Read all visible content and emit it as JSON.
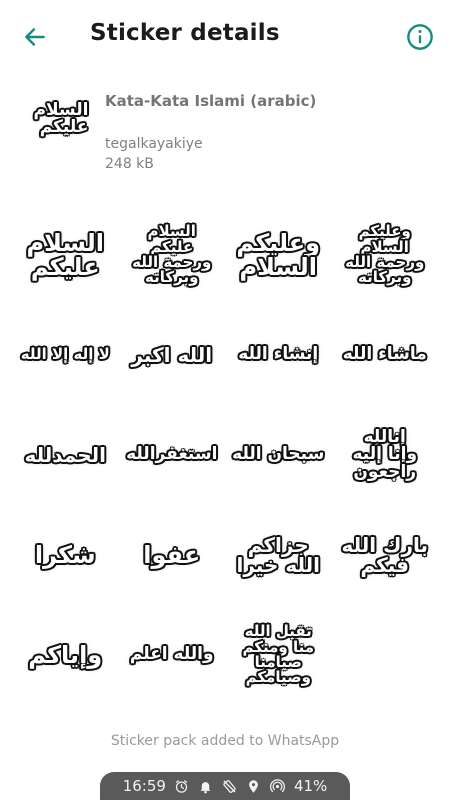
{
  "appbar": {
    "title": "Sticker details"
  },
  "pack": {
    "thumbnail_text": "السلام\nعليكم",
    "name": "Kata-Kata Islami (arabic)",
    "author": "tegalkayakiye",
    "size": "248 kB"
  },
  "stickers": [
    {
      "text": "السلام\nعليكم",
      "size": "s-xl"
    },
    {
      "text": "السلام\nعليكم\nورحمة الله\nوبركاته",
      "size": "s-s"
    },
    {
      "text": "وعليكم\nالسلام",
      "size": "s-xl"
    },
    {
      "text": "وعليكم\nالسلام\nورحمة الله\nوبركاته",
      "size": "s-s"
    },
    {
      "text": "لا إله إلا الله",
      "size": "s-s"
    },
    {
      "text": "الله اكبر",
      "size": "s-l"
    },
    {
      "text": "إنشاء الله",
      "size": "s-m"
    },
    {
      "text": "ماشاء الله",
      "size": "s-m"
    },
    {
      "text": "الحمدلله",
      "size": "s-l"
    },
    {
      "text": "استغفرالله",
      "size": "s-m"
    },
    {
      "text": "سبحان الله",
      "size": "s-m"
    },
    {
      "text": "إنالله\nوإنا إليه\nراجعون",
      "size": "s-m"
    },
    {
      "text": "شكرا",
      "size": "s-xl"
    },
    {
      "text": "عفوا",
      "size": "s-xl"
    },
    {
      "text": "جزاكم\nالله خيرا",
      "size": "s-l"
    },
    {
      "text": "بارك الله\nفيكم",
      "size": "s-l"
    },
    {
      "text": "وإياكم",
      "size": "s-xl"
    },
    {
      "text": "والله اعلم",
      "size": "s-m"
    },
    {
      "text": "تقبل الله\nمنا ومنكم\nصيامنا\nوصيامكم",
      "size": "s-s"
    }
  ],
  "footer": {
    "text": "Sticker pack added to WhatsApp"
  },
  "status": {
    "time": "16:59",
    "battery": "41%"
  },
  "colors": {
    "accent": "#128C7E",
    "status_bg": "#5a5a5a"
  },
  "icons": {
    "back": "arrow-left-icon",
    "info": "info-icon",
    "alarm": "alarm-icon",
    "bell": "bell-icon",
    "rotate": "rotate-off-icon",
    "location": "location-icon",
    "hotspot": "hotspot-icon"
  }
}
